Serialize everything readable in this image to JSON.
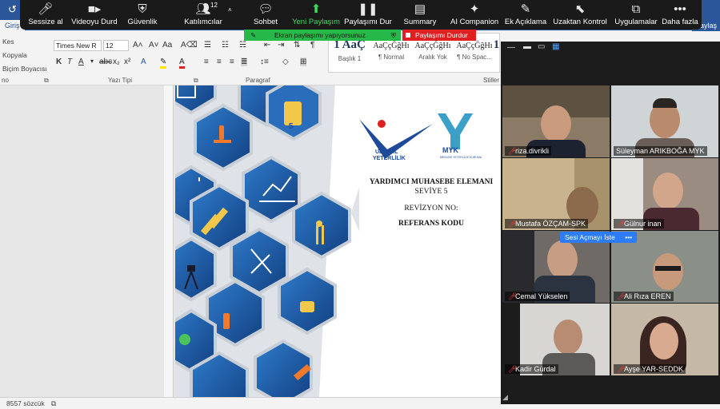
{
  "word": {
    "home_tab": "Giriş",
    "share_label": "Paylaş",
    "clipboard": {
      "cut": "Kes",
      "copy": "Kopyala",
      "format_painter": "Biçim Boyacısı"
    },
    "clipboard_group_fragment": "no",
    "font": {
      "name": "Times New R",
      "size": "12"
    },
    "groups": {
      "font": "Yazı Tipi",
      "paragraph": "Paragraf",
      "styles": "Stiller"
    },
    "styles": [
      {
        "sample": "1 AaÇ",
        "name": "Başlık 1"
      },
      {
        "sample": "AaÇçĞğHı",
        "name": "¶ Normal"
      },
      {
        "sample": "AaÇçĞğHı",
        "name": "Aralık Yok"
      },
      {
        "sample": "AaÇçĞğHı",
        "name": "¶ No Spac..."
      },
      {
        "sample": "1",
        "name": ""
      }
    ],
    "status": {
      "words": "8557 sözcük"
    }
  },
  "document": {
    "logo_left": [
      "ULUSAL",
      "YETERLİLİK"
    ],
    "logo_right": "MYK",
    "logo_right_sub": "MESLEKİ YETERLİLİK KURUMU",
    "title": "YARDIMCI MUHASEBE ELEMANI",
    "level": "SEVİYE 5",
    "revision": "REVİZYON NO:",
    "reference": "REFERANS KODU",
    "hex_icon_number": "5"
  },
  "zoom": {
    "toolbar": [
      {
        "id": "mute",
        "label": "Sessize al",
        "icon": "microphone-icon"
      },
      {
        "id": "video",
        "label": "Videoyu Durd",
        "icon": "camera-icon"
      },
      {
        "id": "security",
        "label": "Güvenlik",
        "icon": "shield-icon"
      },
      {
        "id": "participants",
        "label": "Katılımcılar",
        "icon": "people-icon",
        "count": "12"
      },
      {
        "id": "chat",
        "label": "Sohbet",
        "icon": "chat-bubble-icon"
      },
      {
        "id": "new-share",
        "label": "Yeni Paylaşım",
        "icon": "share-arrow-icon"
      },
      {
        "id": "pause-share",
        "label": "Paylaşımı Dur",
        "icon": "pause-icon"
      },
      {
        "id": "summary",
        "label": "Summary",
        "icon": "document-icon"
      },
      {
        "id": "ai",
        "label": "AI Companion",
        "icon": "sparkle-icon"
      },
      {
        "id": "annotate",
        "label": "Ek Açıklama",
        "icon": "pencil-icon"
      },
      {
        "id": "remote",
        "label": "Uzaktan Kontrol",
        "icon": "pointer-icon"
      },
      {
        "id": "apps",
        "label": "Uygulamalar",
        "icon": "apps-icon"
      },
      {
        "id": "more",
        "label": "Daha fazla",
        "icon": "more-icon"
      }
    ],
    "share_banner": "Ekran paylaşımı yapıyorsunuz",
    "stop_share": "Paylaşımı Durdur",
    "speaking_hint": "Sesi Açmayı İste",
    "colors": {
      "accent_green": "#3ddc5c",
      "stop_red": "#e02020",
      "word_blue": "#2b579a",
      "hex_blue": "#1e5a9e"
    },
    "participants": [
      {
        "name": "riza.divrikli",
        "muted": true,
        "bg": "#8a7a66"
      },
      {
        "name": "Süleyman ARIKBOĞA MYK",
        "muted": false,
        "bg": "#cfd4d6"
      },
      {
        "name": "Mustafa ÖZÇAM-SPK",
        "muted": true,
        "bg": "#c9b38e"
      },
      {
        "name": "Gülnur inan",
        "muted": true,
        "bg": "#9a8c80"
      },
      {
        "name": "Cemal Yükselen",
        "muted": true,
        "bg": "#6f6a65"
      },
      {
        "name": "Ali Rıza EREN",
        "muted": true,
        "bg": "#8a9088"
      },
      {
        "name": "Kadir Gürdal",
        "muted": true,
        "bg": "#d8d6d2"
      },
      {
        "name": "Ayşe YAR-SEDDK",
        "muted": true,
        "bg": "#c5b8a6"
      }
    ]
  }
}
